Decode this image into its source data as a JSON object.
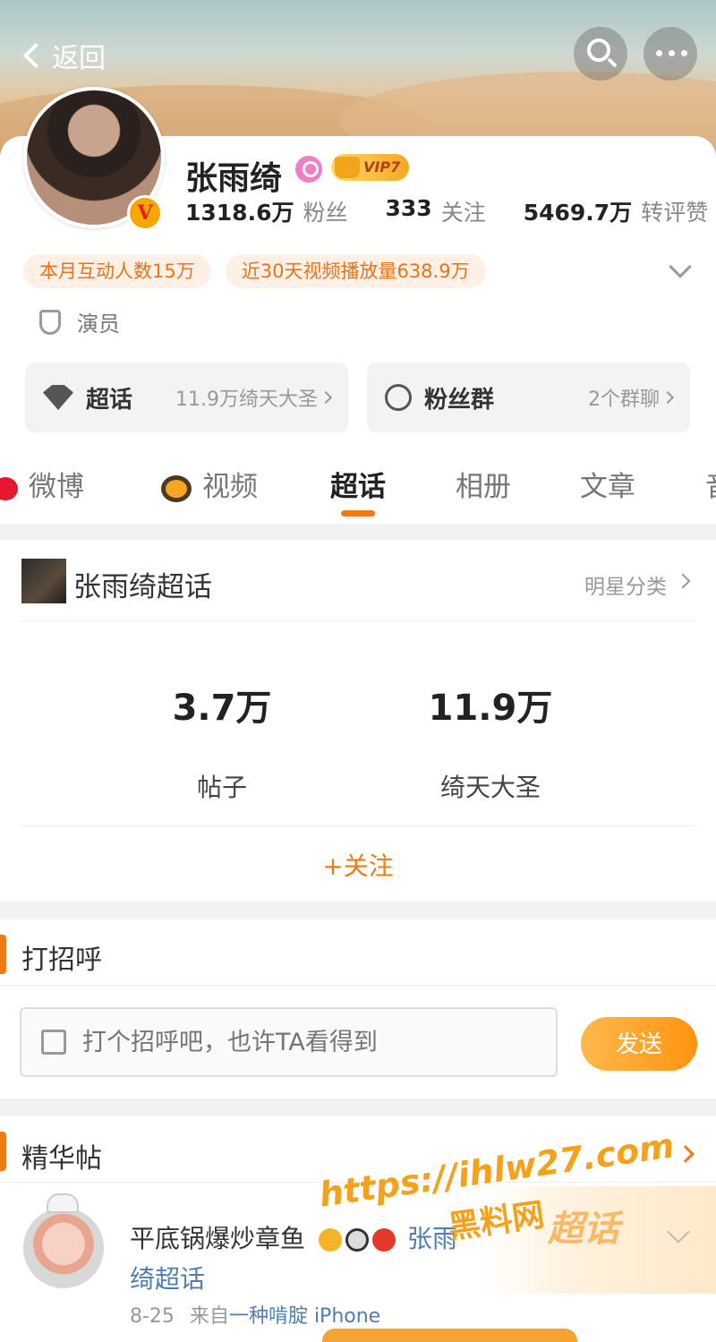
{
  "header": {
    "back_label": "返回",
    "search_icon": "search-icon",
    "more_icon": "more-icon"
  },
  "profile": {
    "name": "张雨绮",
    "vip_label": "VIP7",
    "stats": [
      {
        "value": "1318.6万",
        "label": "粉丝"
      },
      {
        "value": "333",
        "label": "关注"
      },
      {
        "value": "5469.7万",
        "label": "转评赞"
      }
    ],
    "chips": [
      "本月互动人数15万",
      "近30天视频播放量638.9万"
    ],
    "role": "演员",
    "entries": {
      "topic": {
        "title": "超话",
        "sub": "11.9万绮天大圣"
      },
      "fans": {
        "title": "粉丝群",
        "sub": "2个群聊"
      }
    },
    "verify_badge": "V"
  },
  "tabs": [
    {
      "label": "微博"
    },
    {
      "label": "视频"
    },
    {
      "label": "超话"
    },
    {
      "label": "相册"
    },
    {
      "label": "文章"
    },
    {
      "label": "音"
    }
  ],
  "supertopic": {
    "title": "张雨绮超话",
    "category": "明星分类",
    "stats": [
      {
        "value": "3.7万",
        "caption": "帖子"
      },
      {
        "value": "11.9万",
        "caption": "绮天大圣"
      }
    ],
    "follow_label": "+关注"
  },
  "greeting": {
    "title": "打招呼",
    "placeholder": "打个招呼吧，也许TA看得到",
    "send_label": "发送"
  },
  "essence": {
    "title": "精华帖",
    "post": {
      "user": "平底锅爆炒章鱼",
      "mention": "张雨",
      "topic": "绮超话",
      "date": "8-25",
      "from_label": "来自",
      "source": "一种啃腚 iPhone"
    }
  },
  "watermark": {
    "url": "https://ihlw27.com",
    "name": "黑料网",
    "logo": "超话"
  }
}
